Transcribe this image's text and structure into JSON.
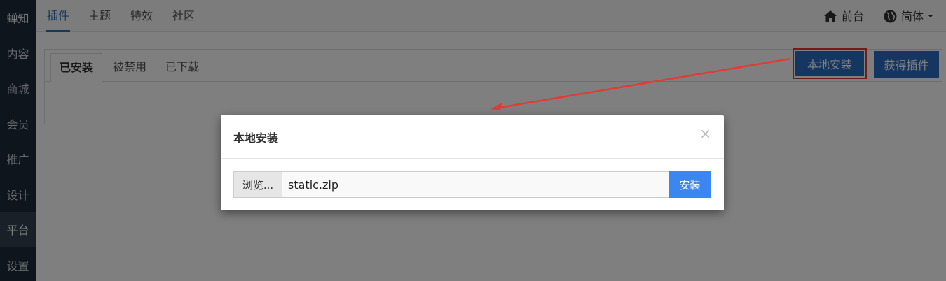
{
  "sidebar": {
    "brand": "蝉知",
    "items": [
      "内容",
      "商城",
      "会员",
      "推广",
      "设计",
      "平台",
      "设置"
    ],
    "active_index": 5
  },
  "topnav": {
    "tabs": [
      "插件",
      "主题",
      "特效",
      "社区"
    ],
    "frontend": "前台",
    "language": "简体"
  },
  "panel": {
    "tabs": [
      "已安装",
      "被禁用",
      "已下载"
    ],
    "local_install": "本地安装",
    "get_plugins": "获得插件"
  },
  "modal": {
    "title": "本地安装",
    "close": "×",
    "browse": "浏览...",
    "filename": "static.zip",
    "install": "安装"
  },
  "colors": {
    "sidebar_bg": "#1d2b3a",
    "primary": "#2a6cc2",
    "accent_blue": "#3b86f0",
    "annotation_red": "#e53935"
  },
  "icons": {
    "home": "home-icon",
    "globe": "globe-icon",
    "caret": "caret-down-icon"
  }
}
